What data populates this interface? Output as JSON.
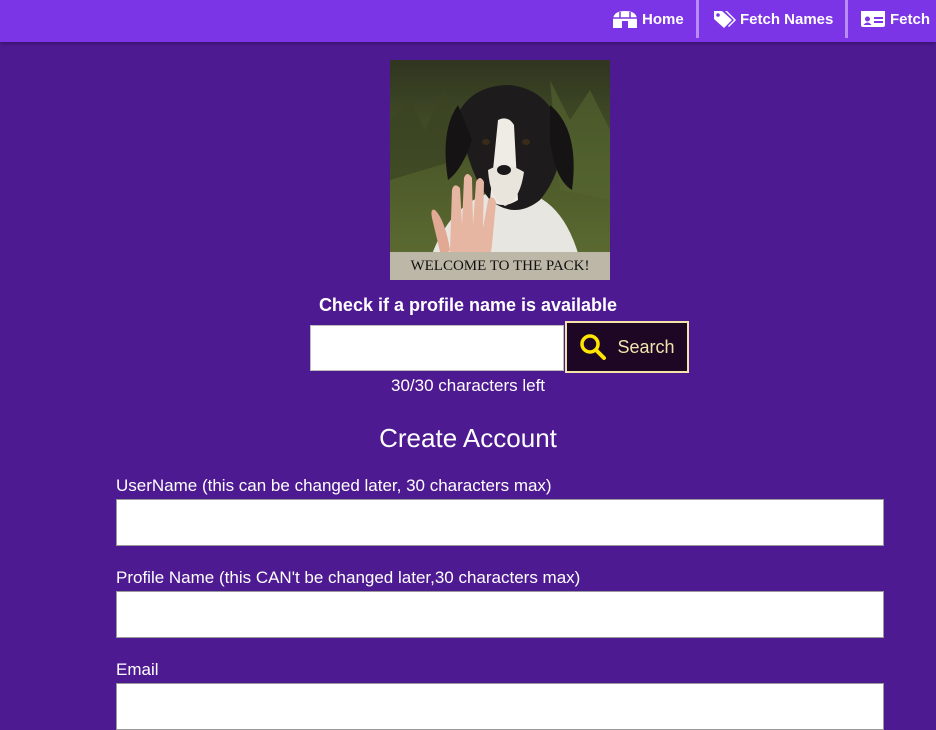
{
  "nav": {
    "items": [
      {
        "label": "Home",
        "icon": "igloo-icon"
      },
      {
        "label": "Fetch Names",
        "icon": "tags-icon"
      },
      {
        "label": "Fetch",
        "icon": "id-card-icon"
      }
    ]
  },
  "hero": {
    "caption": "WELCOME TO THE PACK!"
  },
  "profile_check": {
    "title": "Check if a profile name is available",
    "input_value": "",
    "search_label": "Search",
    "chars_left": "30/30 characters left"
  },
  "create_account": {
    "title": "Create Account",
    "fields": [
      {
        "label": "UserName (this can be changed later, 30 characters max)",
        "value": ""
      },
      {
        "label": "Profile Name (this CAN't be changed later,30 characters max)",
        "value": ""
      },
      {
        "label": "Email",
        "value": ""
      }
    ]
  },
  "colors": {
    "page_bg": "#4e1a92",
    "navbar_bg": "#7b35e6",
    "search_button_bg": "#1e0724",
    "search_icon": "#ffe600"
  }
}
